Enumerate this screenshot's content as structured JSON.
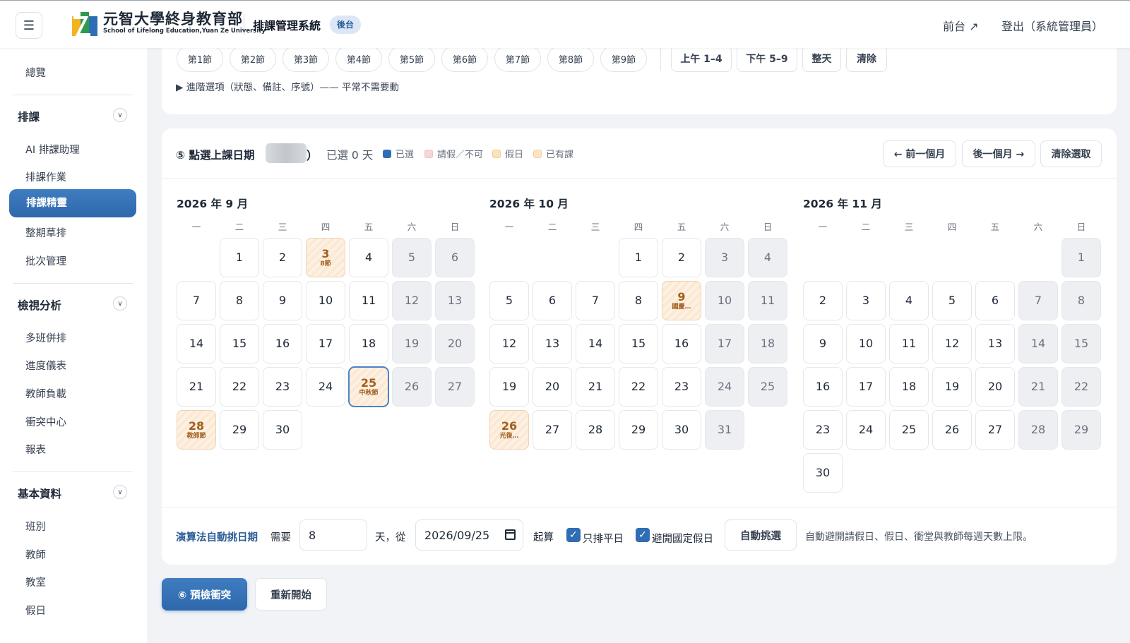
{
  "header": {
    "menu_icon": "☰",
    "logo_cn": "元智大學終身教育部",
    "logo_en": "School of Lifelong Education,Yuan Ze University",
    "system_title": "排課管理系統",
    "badge": "後台",
    "front_link": "前台 ↗",
    "logout": "登出（系統管理員）"
  },
  "sidebar": {
    "overview": "總覽",
    "groups": [
      {
        "title": "排課",
        "items": [
          "AI 排課助理",
          "排課作業",
          "排課精靈",
          "整期草排",
          "批次管理"
        ]
      },
      {
        "title": "檢視分析",
        "items": [
          "多班併排",
          "進度儀表",
          "教師負載",
          "衝突中心",
          "報表"
        ]
      },
      {
        "title": "基本資料",
        "items": [
          "班別",
          "教師",
          "教室",
          "假日"
        ]
      }
    ],
    "active_item": "排課精靈"
  },
  "periods": {
    "buttons": [
      "第1節",
      "第2節",
      "第3節",
      "第4節",
      "第5節",
      "第6節",
      "第7節",
      "第8節",
      "第9節"
    ],
    "ranges": [
      "上午 1–4",
      "下午 5–9",
      "整天",
      "清除"
    ],
    "advanced": "▶ 進階選項（狀態、備註、序號）—— 平常不需要動"
  },
  "date_select": {
    "title": "⑤ 點選上課日期",
    "paren_close": "）",
    "count_text": "已選 0 天",
    "legend": [
      {
        "label": "已選",
        "color": "#2f6db5"
      },
      {
        "label": "請假／不可",
        "color": "#f6d6d6"
      },
      {
        "label": "假日",
        "color": "#fbe2bd"
      },
      {
        "label": "已有課",
        "color": "#fde4c4"
      }
    ],
    "prev": "← 前一個月",
    "next": "後一個月 →",
    "clear": "清除選取",
    "weekdays": [
      "一",
      "二",
      "三",
      "四",
      "五",
      "六",
      "日"
    ]
  },
  "months": [
    {
      "title": "2026 年 9 月",
      "offset": 1,
      "days": 30,
      "notes": {
        "3": "8節",
        "25": "中秋節",
        "28": "教師節"
      },
      "selected": [
        25
      ]
    },
    {
      "title": "2026 年 10 月",
      "offset": 3,
      "days": 31,
      "notes": {
        "9": "國慶…",
        "26": "光復…"
      },
      "selected": []
    },
    {
      "title": "2026 年 11 月",
      "offset": 6,
      "days": 30,
      "notes": {},
      "selected": []
    }
  ],
  "auto": {
    "label": "演算法自動挑日期",
    "need": "需要",
    "days_value": "8",
    "days_from": "天，從",
    "start_date": "2026/09/25",
    "start_suffix": "起算",
    "check1": "只排平日",
    "check2": "避開國定假日",
    "button": "自動挑選",
    "hint": "自動避開請假日、假日、衝堂與教師每週天數上限。"
  },
  "actions": {
    "precheck": "⑥ 預檢衝突",
    "restart": "重新開始"
  }
}
